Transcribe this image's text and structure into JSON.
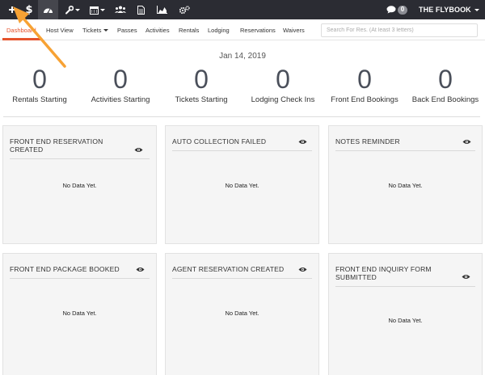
{
  "topbar": {
    "buttons": [
      {
        "icon": "plus-icon",
        "has_caret": false
      },
      {
        "icon": "dollar-icon",
        "has_caret": false
      },
      {
        "icon": "dashboard-gauge-icon",
        "has_caret": false
      },
      {
        "icon": "wrench-icon",
        "has_caret": true
      },
      {
        "icon": "calendar-icon",
        "has_caret": true
      },
      {
        "icon": "users-icon",
        "has_caret": false
      },
      {
        "icon": "document-icon",
        "has_caret": false
      },
      {
        "icon": "area-chart-icon",
        "has_caret": false
      },
      {
        "icon": "cogs-icon",
        "has_caret": false
      }
    ],
    "chat_icon": "chat-bubble-icon",
    "chat_count": "0",
    "brand": "THE FLYBOOK"
  },
  "tabs": [
    "Dashboard",
    "Host View",
    "Tickets",
    "Passes",
    "Activities",
    "Rentals",
    "Lodging",
    "Reservations",
    "Waivers"
  ],
  "tabs_with_caret": [
    "Tickets"
  ],
  "search": {
    "placeholder": "Search For Res. (At least 3 letters)"
  },
  "date": "Jan 14, 2019",
  "stats": [
    {
      "value": "0",
      "label": "Rentals Starting"
    },
    {
      "value": "0",
      "label": "Activities Starting"
    },
    {
      "value": "0",
      "label": "Tickets Starting"
    },
    {
      "value": "0",
      "label": "Lodging Check Ins"
    },
    {
      "value": "0",
      "label": "Front End Bookings"
    },
    {
      "value": "0",
      "label": "Back End Bookings"
    }
  ],
  "cards": [
    {
      "title": "FRONT END RESERVATION CREATED",
      "empty": "No Data Yet."
    },
    {
      "title": "AUTO COLLECTION FAILED",
      "empty": "No Data Yet."
    },
    {
      "title": "NOTES REMINDER",
      "empty": "No Data Yet."
    },
    {
      "title": "FRONT END PACKAGE BOOKED",
      "empty": "No Data Yet."
    },
    {
      "title": "AGENT RESERVATION CREATED",
      "empty": "No Data Yet."
    },
    {
      "title": "FRONT END INQUIRY FORM SUBMITTED",
      "empty": "No Data Yet."
    }
  ],
  "colors": {
    "topbar_bg": "#2b2c33",
    "accent": "#e5532d",
    "arrow": "#f7a234",
    "stat_number": "#4a4f5a",
    "card_bg": "#f5f5f5"
  }
}
